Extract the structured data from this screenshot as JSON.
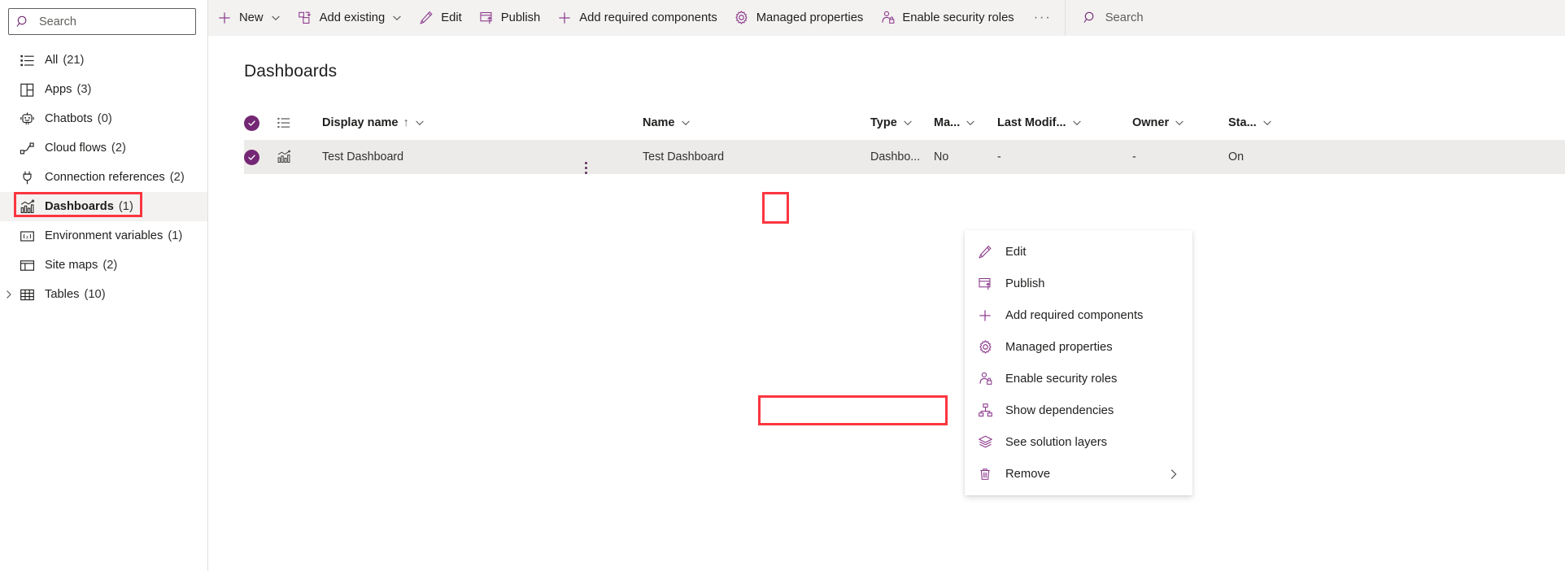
{
  "colors": {
    "accent": "#742774",
    "icon_purple": "#8c3a8c",
    "highlight_red": "#fb3640",
    "row_selected_bg": "#edebe9",
    "cmdbar_bg": "#f3f2f1",
    "text": "#201f1e"
  },
  "sidebar": {
    "search": {
      "placeholder": "Search",
      "value": "",
      "icon": "search-icon"
    },
    "items": [
      {
        "label": "All",
        "count": "(21)",
        "icon": "list-icon",
        "selected": false,
        "expandable": false
      },
      {
        "label": "Apps",
        "count": "(3)",
        "icon": "apps-grid-icon",
        "selected": false,
        "expandable": false
      },
      {
        "label": "Chatbots",
        "count": "(0)",
        "icon": "chatbot-icon",
        "selected": false,
        "expandable": false
      },
      {
        "label": "Cloud flows",
        "count": "(2)",
        "icon": "cloud-flow-icon",
        "selected": false,
        "expandable": false
      },
      {
        "label": "Connection references",
        "count": "(2)",
        "icon": "plug-icon",
        "selected": false,
        "expandable": false
      },
      {
        "label": "Dashboards",
        "count": "(1)",
        "icon": "dashboard-chart-icon",
        "selected": true,
        "expandable": false
      },
      {
        "label": "Environment variables",
        "count": "(1)",
        "icon": "variable-icon",
        "selected": false,
        "expandable": false
      },
      {
        "label": "Site maps",
        "count": "(2)",
        "icon": "sitemap-layout-icon",
        "selected": false,
        "expandable": false
      },
      {
        "label": "Tables",
        "count": "(10)",
        "icon": "table-icon",
        "selected": false,
        "expandable": true
      }
    ]
  },
  "commandbar": {
    "items": [
      {
        "label": "New",
        "icon": "plus-icon",
        "chevron": true
      },
      {
        "label": "Add existing",
        "icon": "add-existing-icon",
        "chevron": true
      },
      {
        "label": "Edit",
        "icon": "pencil-icon",
        "chevron": false
      },
      {
        "label": "Publish",
        "icon": "publish-icon",
        "chevron": false
      },
      {
        "label": "Add required components",
        "icon": "plus-icon",
        "chevron": false
      },
      {
        "label": "Managed properties",
        "icon": "gear-icon",
        "chevron": false
      },
      {
        "label": "Enable security roles",
        "icon": "security-roles-icon",
        "chevron": false
      }
    ],
    "overflow_label": "···",
    "search": {
      "label": "Search",
      "icon": "search-icon"
    }
  },
  "main": {
    "page_title": "Dashboards",
    "grid": {
      "columns": [
        {
          "key": "check",
          "label": "",
          "icon": "select-all-checkbox",
          "sortable": false
        },
        {
          "key": "type_icon",
          "label": "",
          "icon": "list-icon",
          "sortable": false
        },
        {
          "key": "display_name",
          "label": "Display name",
          "sorted": "asc",
          "sort_glyph": "↑",
          "chevron": true
        },
        {
          "key": "name",
          "label": "Name",
          "chevron": true
        },
        {
          "key": "type",
          "label": "Type",
          "chevron": true
        },
        {
          "key": "managed",
          "label": "Ma...",
          "chevron": true
        },
        {
          "key": "last_modified",
          "label": "Last Modif...",
          "chevron": true
        },
        {
          "key": "owner",
          "label": "Owner",
          "chevron": true
        },
        {
          "key": "status",
          "label": "Sta...",
          "chevron": true
        }
      ],
      "rows": [
        {
          "selected": true,
          "row_icon": "dashboard-chart-icon",
          "display_name": "Test Dashboard",
          "name": "Test Dashboard",
          "type": "Dashbo...",
          "managed": "No",
          "last_modified": "-",
          "owner": "-",
          "status": "On",
          "more_label": "⋮"
        }
      ]
    }
  },
  "context_menu": {
    "items": [
      {
        "label": "Edit",
        "icon": "pencil-icon",
        "submenu": false,
        "highlighted": false
      },
      {
        "label": "Publish",
        "icon": "publish-icon",
        "submenu": false,
        "highlighted": false
      },
      {
        "label": "Add required components",
        "icon": "plus-icon",
        "submenu": false,
        "highlighted": false
      },
      {
        "label": "Managed properties",
        "icon": "gear-icon",
        "submenu": false,
        "highlighted": false
      },
      {
        "label": "Enable security roles",
        "icon": "security-roles-icon",
        "submenu": false,
        "highlighted": true
      },
      {
        "label": "Show dependencies",
        "icon": "dependencies-icon",
        "submenu": false,
        "highlighted": false
      },
      {
        "label": "See solution layers",
        "icon": "layers-icon",
        "submenu": false,
        "highlighted": false
      },
      {
        "label": "Remove",
        "icon": "trash-icon",
        "submenu": true,
        "highlighted": false
      }
    ]
  }
}
